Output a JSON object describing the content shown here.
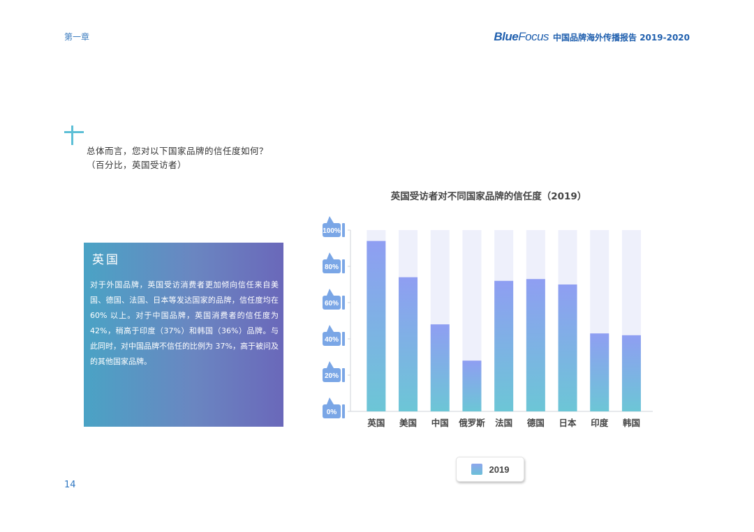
{
  "header": {
    "chapter": "第一章",
    "brand_blue": "Blue",
    "brand_focus": "Focus",
    "report_title": "中国品牌海外传播报告 2019-2020"
  },
  "question": {
    "line1": "总体而言，您对以下国家品牌的信任度如何？",
    "line2": "（百分比，英国受访者）"
  },
  "panel": {
    "title": "英国",
    "body": "对于外国品牌，英国受访消费者更加倾向信任来自美国、德国、法国、日本等发达国家的品牌，信任度均在 60% 以上。对于中国品牌，英国消费者的信任度为 42%，稍高于印度（37%）和韩国（36%）品牌。与此同时，对中国品牌不信任的比例为 37%，高于被问及的其他国家品牌。"
  },
  "chart_data": {
    "type": "bar",
    "title": "英国受访者对不同国家品牌的信任度（2019）",
    "categories": [
      "英国",
      "美国",
      "中国",
      "俄罗斯",
      "法国",
      "德国",
      "日本",
      "印度",
      "韩国"
    ],
    "series": [
      {
        "name": "2019",
        "values": [
          94,
          74,
          48,
          28,
          72,
          73,
          70,
          43,
          42
        ]
      }
    ],
    "ylim": [
      0,
      100
    ],
    "yticks": [
      "0%",
      "20%",
      "40%",
      "60%",
      "80%",
      "100%"
    ],
    "legend": "bottom-center",
    "colors": {
      "bar_top": "#8f9ef2",
      "bar_bottom": "#6cc6d6",
      "track": "#eef0fb",
      "tick_badge": "#7aa6e6"
    }
  },
  "footer": {
    "page_number": "14"
  }
}
